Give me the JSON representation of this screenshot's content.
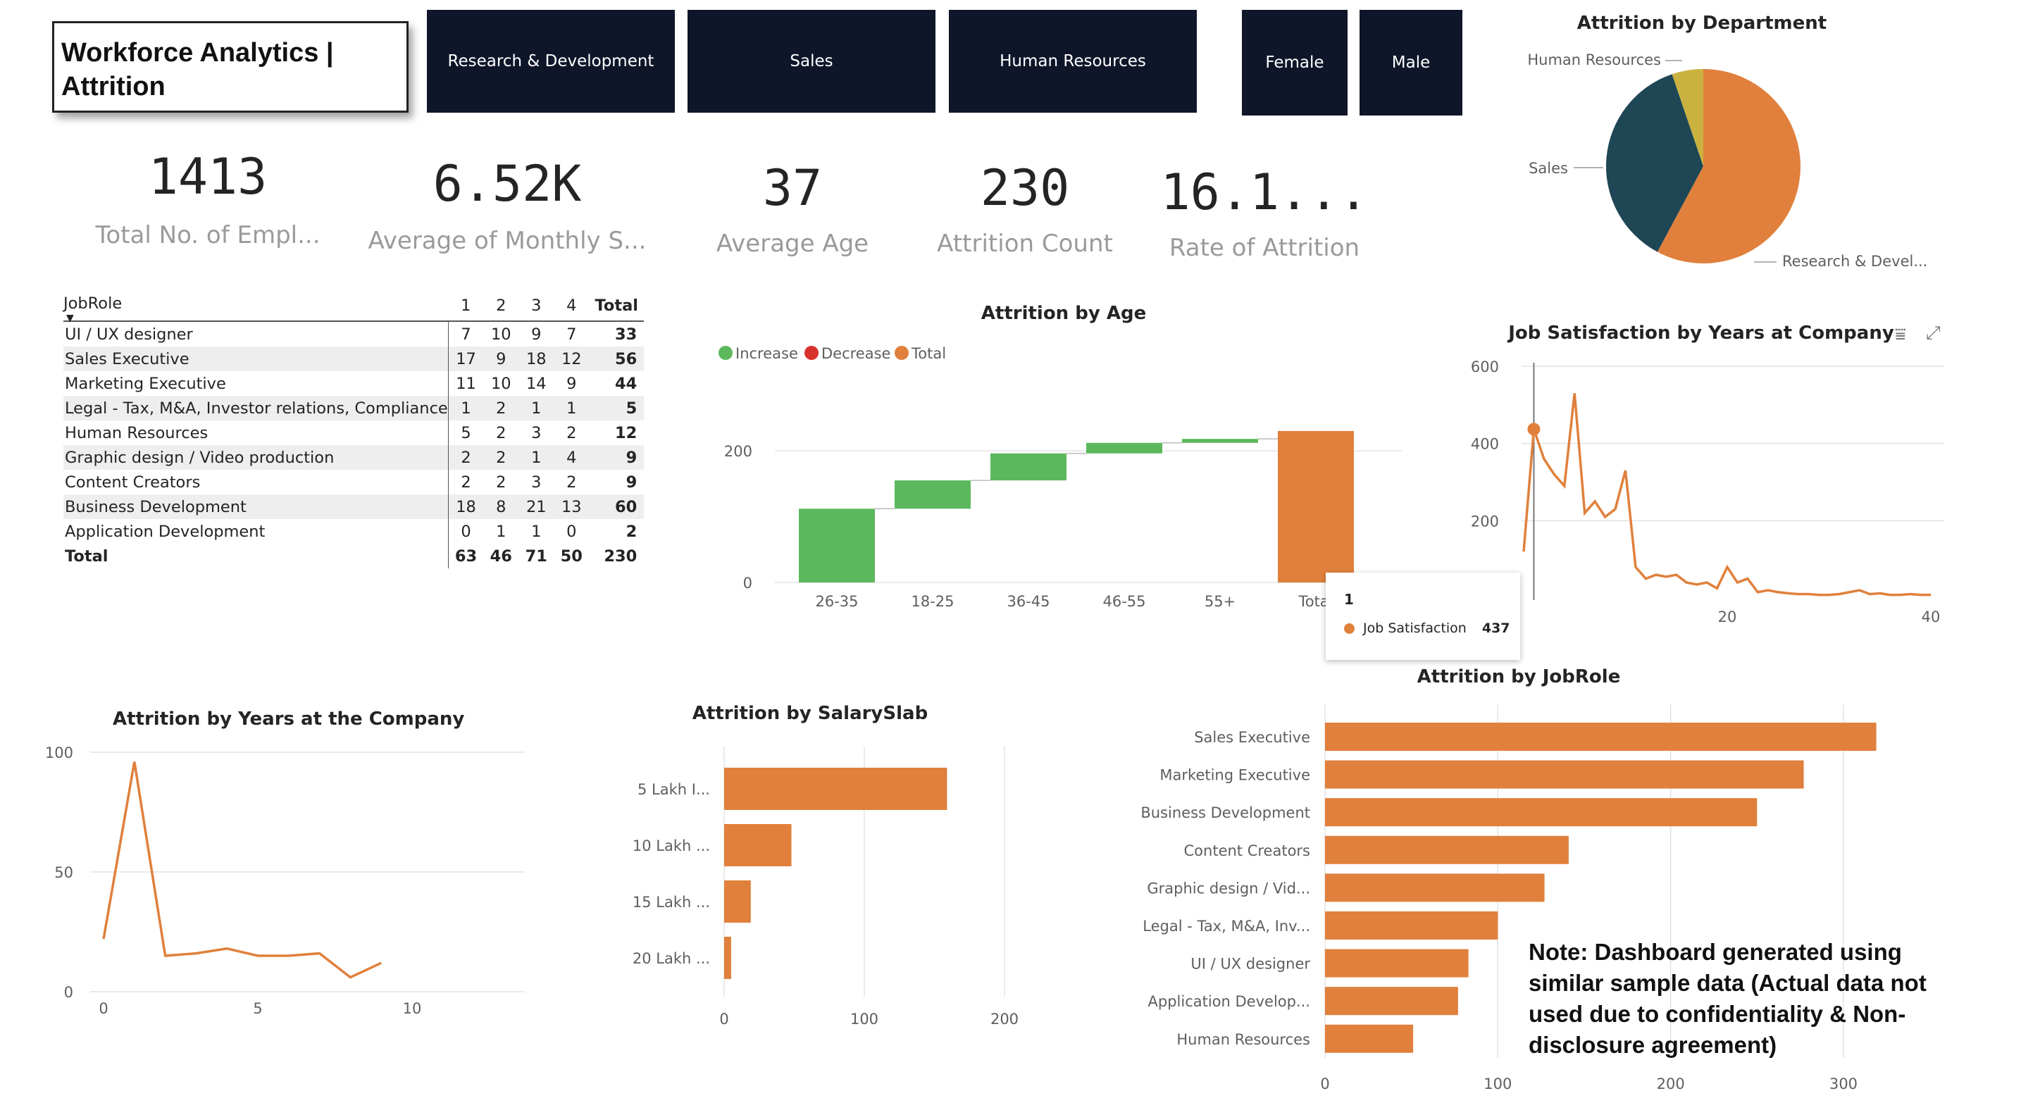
{
  "header": {
    "title_line1": "Workforce Analytics |",
    "title_line2": "Attrition",
    "slicers": [
      "Research & Development",
      "Sales",
      "Human Resources",
      "Female",
      "Male"
    ]
  },
  "kpis": [
    {
      "value": "1413",
      "label": "Total No. of Empl..."
    },
    {
      "value": "6.52K",
      "label": "Average of Monthly S..."
    },
    {
      "value": "37",
      "label": "Average Age"
    },
    {
      "value": "230",
      "label": "Attrition Count"
    },
    {
      "value": "16.1...",
      "label": "Rate of Attrition"
    }
  ],
  "matrix": {
    "row_header": "JobRole",
    "columns": [
      "1",
      "2",
      "3",
      "4",
      "Total"
    ],
    "rows": [
      {
        "role": "UI / UX designer",
        "vals": [
          "7",
          "10",
          "9",
          "7"
        ],
        "total": "33"
      },
      {
        "role": "Sales Executive",
        "vals": [
          "17",
          "9",
          "18",
          "12"
        ],
        "total": "56"
      },
      {
        "role": "Marketing Executive",
        "vals": [
          "11",
          "10",
          "14",
          "9"
        ],
        "total": "44"
      },
      {
        "role": "Legal - Tax, M&A, Investor relations, Compliance",
        "vals": [
          "1",
          "2",
          "1",
          "1"
        ],
        "total": "5"
      },
      {
        "role": "Human Resources",
        "vals": [
          "5",
          "2",
          "3",
          "2"
        ],
        "total": "12"
      },
      {
        "role": "Graphic design / Video production",
        "vals": [
          "2",
          "2",
          "1",
          "4"
        ],
        "total": "9"
      },
      {
        "role": "Content Creators",
        "vals": [
          "2",
          "2",
          "3",
          "2"
        ],
        "total": "9"
      },
      {
        "role": "Business Development",
        "vals": [
          "18",
          "8",
          "21",
          "13"
        ],
        "total": "60"
      },
      {
        "role": "Application Development",
        "vals": [
          "0",
          "1",
          "1",
          "0"
        ],
        "total": "2"
      }
    ],
    "total_row": {
      "role": "Total",
      "vals": [
        "63",
        "46",
        "71",
        "50"
      ],
      "total": "230"
    }
  },
  "tooltip": {
    "title": "1",
    "label": "Job Satisfaction",
    "value": "437"
  },
  "note": [
    "Note: Dashboard generated using",
    "similar sample data (Actual data not",
    "used due to confidentiality & Non-",
    "disclosure agreement)"
  ],
  "colors": {
    "orange": "#E0803C",
    "teal": "#1E4655",
    "gold": "#C9B23F",
    "green": "#5CB85C",
    "red": "#D9312B",
    "navy": "#0F1629"
  },
  "chart_data": [
    {
      "id": "dept",
      "type": "pie",
      "title": "Attrition by Department",
      "labels": [
        "Research & Devel...",
        "Sales",
        "Human Resources"
      ],
      "values": [
        133,
        85,
        12
      ]
    },
    {
      "id": "age",
      "type": "waterfall",
      "title": "Attrition by Age",
      "legend": [
        "Increase",
        "Decrease",
        "Total"
      ],
      "categories": [
        "26-35",
        "18-25",
        "36-45",
        "46-55",
        "55+",
        "Total"
      ],
      "values": [
        112,
        43,
        41,
        16,
        6,
        230
      ],
      "ylim": [
        0,
        240
      ],
      "yticks": [
        0,
        200
      ]
    },
    {
      "id": "jobsat",
      "type": "line",
      "title": "Job Satisfaction by Years at Company",
      "x": [
        0,
        1,
        2,
        3,
        4,
        5,
        6,
        7,
        8,
        9,
        10,
        11,
        12,
        13,
        14,
        15,
        16,
        17,
        18,
        19,
        20,
        21,
        22,
        23,
        24,
        25,
        26,
        27,
        28,
        29,
        30,
        31,
        32,
        33,
        34,
        35,
        36,
        37,
        38,
        39,
        40
      ],
      "y": [
        120,
        437,
        360,
        320,
        290,
        530,
        220,
        250,
        210,
        230,
        330,
        80,
        50,
        60,
        55,
        60,
        40,
        35,
        40,
        25,
        80,
        40,
        50,
        15,
        20,
        15,
        12,
        10,
        10,
        8,
        8,
        10,
        15,
        20,
        10,
        12,
        8,
        8,
        10,
        8,
        8
      ],
      "ylim": [
        0,
        600
      ],
      "yticks": [
        200,
        400,
        600
      ],
      "xticks": [
        20,
        40
      ]
    },
    {
      "id": "years",
      "type": "line",
      "title": "Attrition by Years at the Company",
      "x": [
        0,
        1,
        2,
        3,
        4,
        5,
        6,
        7,
        8,
        9
      ],
      "y": [
        22,
        96,
        15,
        16,
        18,
        15,
        15,
        16,
        6,
        12
      ],
      "ylim": [
        0,
        100
      ],
      "yticks": [
        0,
        50,
        100
      ],
      "xticks": [
        0,
        5,
        10
      ]
    },
    {
      "id": "salary",
      "type": "bar",
      "title": "Attrition by SalarySlab",
      "categories": [
        "5 Lakh I...",
        "10 Lakh ...",
        "15 Lakh ...",
        "20 Lakh ..."
      ],
      "values": [
        159,
        48,
        19,
        5
      ],
      "xlim": [
        0,
        200
      ],
      "xticks": [
        0,
        100,
        200
      ]
    },
    {
      "id": "jobrole",
      "type": "bar",
      "title": "Attrition by JobRole",
      "categories": [
        "Sales Executive",
        "Marketing Executive",
        "Business Development",
        "Content Creators",
        "Graphic design / Vid...",
        "Legal - Tax, M&A, Inv...",
        "UI / UX designer",
        "Application Develop...",
        "Human Resources"
      ],
      "values": [
        319,
        277,
        250,
        141,
        127,
        100,
        83,
        77,
        51
      ],
      "xlim": [
        0,
        300
      ],
      "xticks": [
        0,
        100,
        200,
        300
      ]
    }
  ]
}
